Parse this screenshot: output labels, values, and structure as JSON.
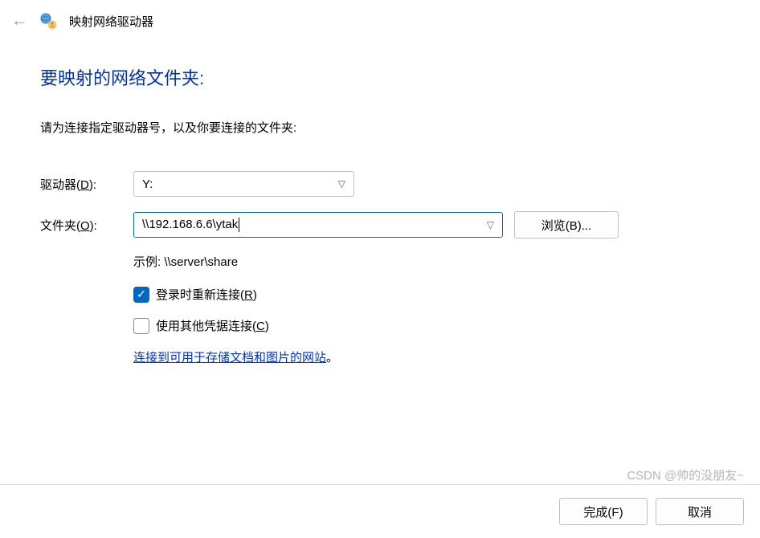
{
  "header": {
    "title": "映射网络驱动器"
  },
  "heading": "要映射的网络文件夹:",
  "instruction": "请为连接指定驱动器号，以及你要连接的文件夹:",
  "drive": {
    "label_pre": "驱动器(",
    "label_short": "D",
    "label_post": "):",
    "value": "Y:"
  },
  "folder": {
    "label_pre": "文件夹(",
    "label_short": "O",
    "label_post": "):",
    "value": "\\\\192.168.6.6\\ytak"
  },
  "browse": {
    "label": "浏览(B)..."
  },
  "example": "示例: \\\\server\\share",
  "reconnect": {
    "label_pre": "登录时重新连接(",
    "label_short": "R",
    "label_post": ")",
    "checked": true
  },
  "credentials": {
    "label_pre": "使用其他凭据连接(",
    "label_short": "C",
    "label_post": ")",
    "checked": false
  },
  "link_text": "连接到可用于存储文档和图片的网站",
  "link_suffix": "。",
  "finish": {
    "label": "完成(F)"
  },
  "cancel": {
    "label": "取消"
  },
  "watermark": "CSDN @帅的没朋友~"
}
